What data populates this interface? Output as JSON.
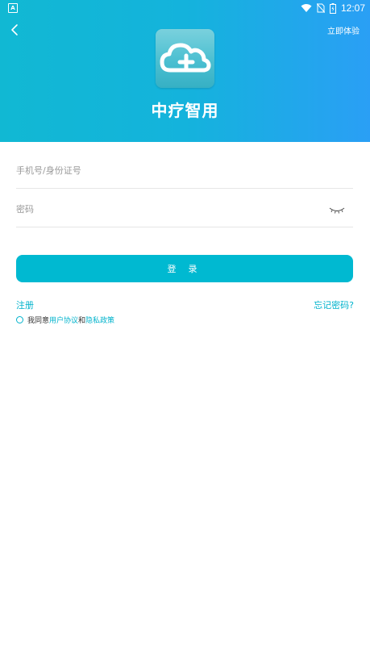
{
  "status_bar": {
    "time": "12:07",
    "left_icon_letter": "A"
  },
  "header": {
    "trial_label": "立即体验",
    "app_title": "中疗智用",
    "background_start": "#11b8d3",
    "background_end": "#2a9ff5"
  },
  "form": {
    "username_placeholder": "手机号/身份证号",
    "password_placeholder": "密码",
    "login_label": "登 录",
    "register_label": "注册",
    "forgot_label": "忘记密码?",
    "agreement": {
      "prefix": "我同意",
      "user_agreement": "用户协议",
      "conjunction": "和",
      "privacy_policy": "隐私政策"
    }
  },
  "colors": {
    "accent": "#00b9d1",
    "link": "#00b3cc"
  },
  "icons": [
    "back-chevron-icon",
    "cloud-plus-logo-icon",
    "eye-closed-icon",
    "wifi-icon",
    "no-sim-icon",
    "battery-icon"
  ]
}
